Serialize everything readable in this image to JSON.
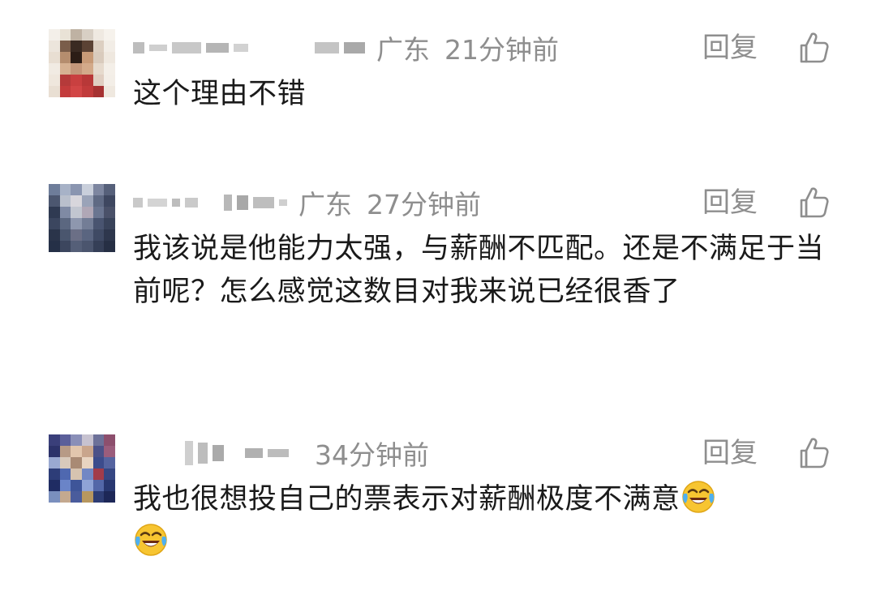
{
  "comments": [
    {
      "region": "广东",
      "time": "21分钟前",
      "reply_label": "回复",
      "text": "这个理由不错",
      "emojis": 0
    },
    {
      "region": "广东",
      "time": "27分钟前",
      "reply_label": "回复",
      "text": "我该说是他能力太强，与薪酬不匹配。还是不满足于当前呢？怎么感觉这数目对我来说已经很香了",
      "emojis": 0
    },
    {
      "region": "",
      "time": "34分钟前",
      "reply_label": "回复",
      "text": "我也很想投自己的票表示对薪酬极度不满意",
      "emojis": 2,
      "emoji_name": "face-with-tears-of-joy"
    }
  ],
  "icons": {
    "like": "thumbs-up-outline-icon"
  },
  "colors": {
    "meta_text": "#8e8e8e",
    "body_text": "#1a1a1a",
    "background": "#ffffff"
  }
}
